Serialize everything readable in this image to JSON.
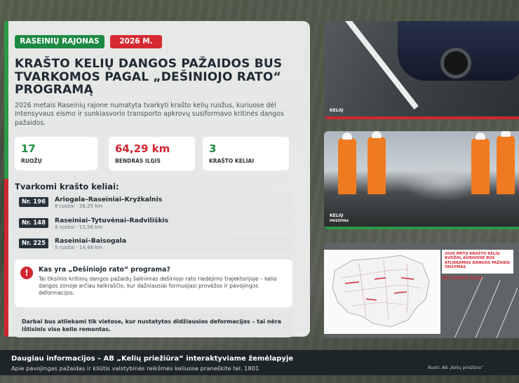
{
  "tags": {
    "region": "RASEINIŲ RAJONAS",
    "year": "2026 M."
  },
  "title": "KRAŠTO KELIŲ DANGOS PAŽAIDOS BUS TVARKOMOS PAGAL „DEŠINIOJO RATO“ PROGRAMĄ",
  "lead": "2026 metais Raseinių rajone numatyta tvarkyti krašto kelių ruožus, kuriuose dėl intensyvaus eismo ir sunkiasvorio transporto apkrovų susiformavo kritinės dangos pažaidos.",
  "stats": [
    {
      "value": "17",
      "label": "RUOŽŲ"
    },
    {
      "value": "64,29 km",
      "label": "BENDRAS ILGIS"
    },
    {
      "value": "3",
      "label": "KRAŠTO KELIAI"
    }
  ],
  "roads_heading": "Tvarkomi krašto keliai:",
  "roads": [
    {
      "nr": "Nr. 196",
      "name": "Ariogala–Raseiniai–Kryžkalnis",
      "meta": "8 ruožai · 36,25 km"
    },
    {
      "nr": "Nr. 148",
      "name": "Raseiniai–Tytuvėnai–Radviliškis",
      "meta": "4 ruožai · 13,56 km"
    },
    {
      "nr": "Nr. 225",
      "name": "Raseiniai–Baisogala",
      "meta": "5 ruožai · 14,48 km"
    }
  ],
  "info": {
    "icon": "!",
    "title": "Kas yra „Dešiniojo rato“ programa?",
    "body": "Tai tikslinis kritinių dangos pažaidų šalinimas dešiniojo rato riedėjimo trajektorijoje – kelio dangos zonoje arčiau kelkraščio, kur dažniausiai formuojasi provėžos ir pavojingos deformacijos."
  },
  "note": "Darbai bus atliekami tik vietose, kur nustatytos didžiausios deformacijos – tai nėra ištisinis viso kelio remontas.",
  "photos": {
    "watermark": "KELIŲ",
    "watermark2": "PRIEŽIŪRA",
    "map_legend": "2026 METŲ KRAŠTO KELIŲ RUOŽAI, KURIUOSE BUS ATLIEKAMAS DANGOS PAŽAIDŲ TAISYMAS",
    "map_button": "VISI KRAŠTO KELIAI"
  },
  "footer": {
    "title": "Daugiau informacijos – AB „Kelių priežiūra“ interaktyviame žemėlapyje",
    "sub": "Apie pavojingas pažaidas ir kliūtis valstybinės reikšmės keliuose praneškite tel. 1801",
    "source": "Nuotr. AB „Kelių priežiūra“"
  },
  "colors": {
    "green": "#1d8a43",
    "red": "#d52a31",
    "dark": "#1d2529"
  }
}
